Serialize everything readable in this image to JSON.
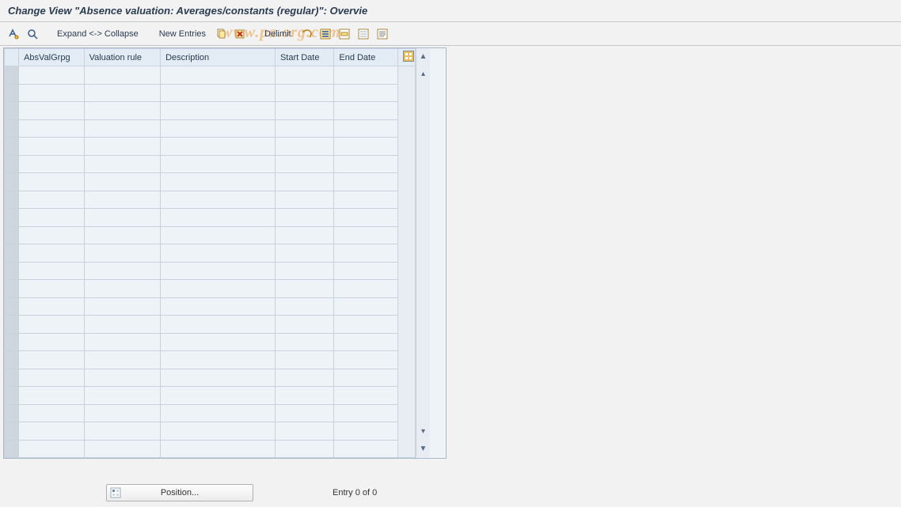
{
  "title": "Change View \"Absence valuation: Averages/constants (regular)\": Overvie",
  "toolbar": {
    "expand_collapse_label": "Expand <-> Collapse",
    "new_entries_label": "New Entries",
    "delimit_label": "Delimit"
  },
  "watermark_text": "www.pa.org.com",
  "table": {
    "columns": {
      "absvalgrpg": "AbsValGrpg",
      "valuation_rule": "Valuation rule",
      "description": "Description",
      "start_date": "Start Date",
      "end_date": "End Date"
    },
    "row_count": 22,
    "rows": []
  },
  "footer": {
    "position_label": "Position...",
    "entry_status": "Entry 0 of 0"
  }
}
